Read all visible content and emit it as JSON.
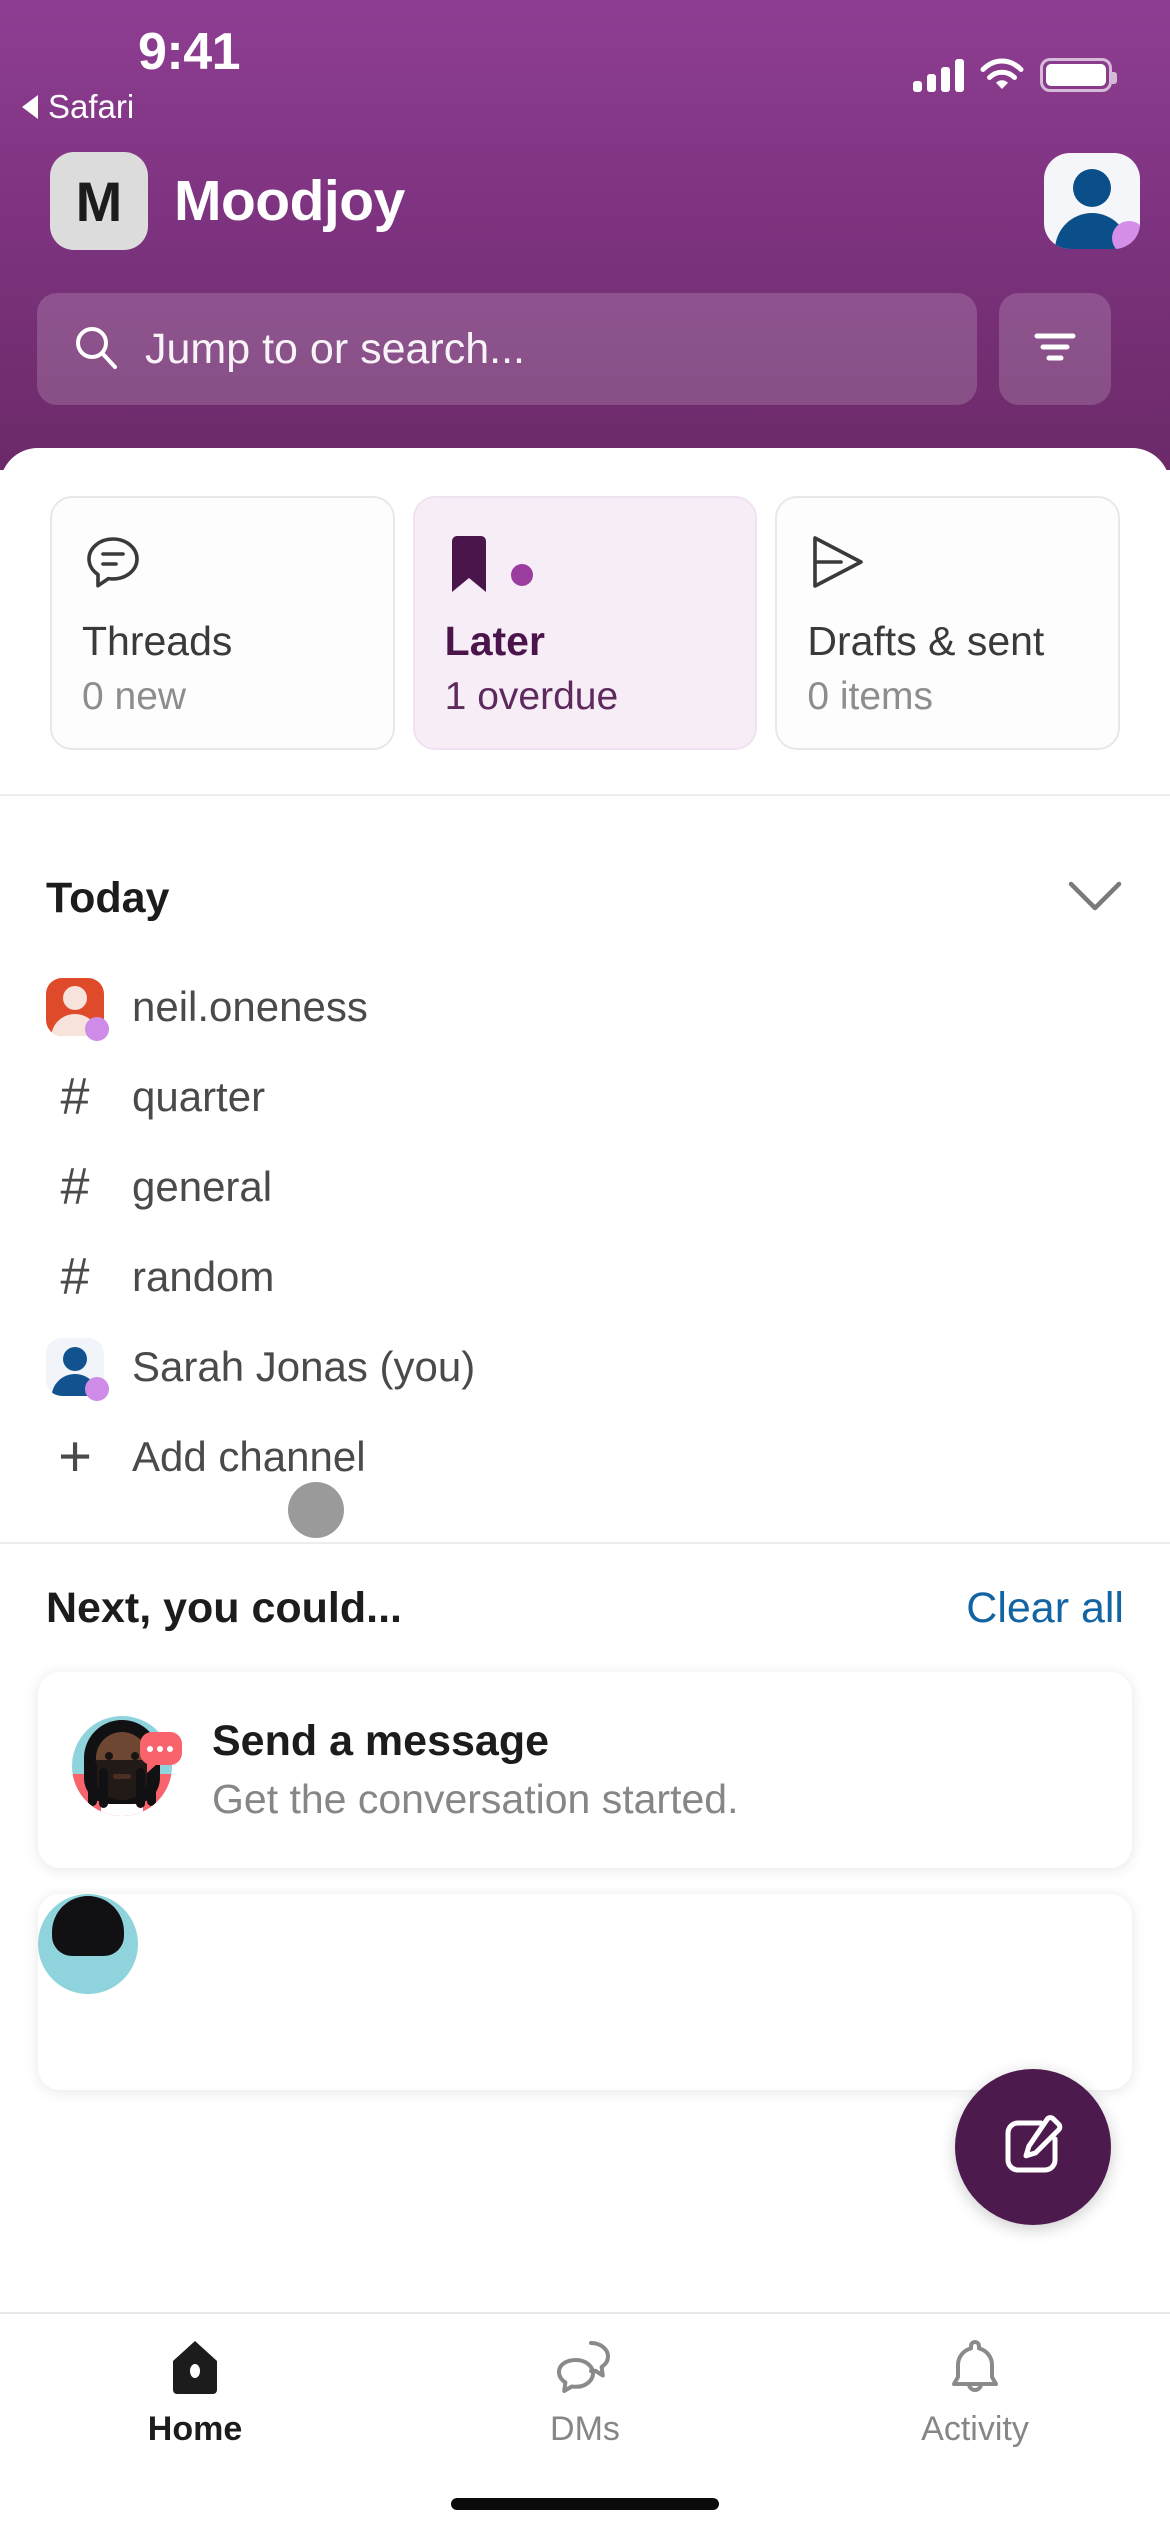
{
  "status_bar": {
    "time": "9:41",
    "back_app_label": "Safari",
    "signal_icon": "cellular-signal-icon",
    "wifi_icon": "wifi-icon",
    "battery_icon": "battery-icon"
  },
  "header": {
    "workspace_initial": "M",
    "workspace_name": "Moodjoy",
    "avatar_icon": "user-avatar-icon",
    "accent_purple": "#7E3380",
    "dark_purple": "#4A154B"
  },
  "search": {
    "placeholder": "Jump to or search...",
    "search_icon": "search-icon",
    "filter_icon": "filter-icon"
  },
  "quick_cards": [
    {
      "icon": "threads-icon",
      "title": "Threads",
      "subtitle": "0 new",
      "active": false,
      "badge": false
    },
    {
      "icon": "bookmark-icon",
      "title": "Later",
      "subtitle": "1 overdue",
      "active": true,
      "badge": true
    },
    {
      "icon": "paper-plane-icon",
      "title": "Drafts & sent",
      "subtitle": "0 items",
      "active": false,
      "badge": false
    }
  ],
  "today": {
    "label": "Today",
    "collapse_icon": "chevron-down-icon",
    "items": [
      {
        "type": "dm",
        "avatar": "avatar-red",
        "name": "neil.oneness",
        "presence": true
      },
      {
        "type": "channel",
        "icon": "hash-icon",
        "name": "quarter"
      },
      {
        "type": "channel",
        "icon": "hash-icon",
        "name": "general"
      },
      {
        "type": "channel",
        "icon": "hash-icon",
        "name": "random"
      },
      {
        "type": "dm",
        "avatar": "avatar-blue",
        "name": "Sarah Jonas (you)",
        "presence": true
      },
      {
        "type": "action",
        "icon": "plus-icon",
        "name": "Add channel"
      }
    ]
  },
  "next_section": {
    "label": "Next, you could...",
    "clear_all": "Clear all",
    "clear_all_color": "#1264A3",
    "suggestions": [
      {
        "avatar": "illustration-avatar-person-with-locs",
        "title": "Send a message",
        "subtitle": "Get the conversation started."
      }
    ]
  },
  "compose_fab": {
    "icon": "compose-icon",
    "color": "#4D1A4D"
  },
  "tabbar": {
    "tabs": [
      {
        "icon": "home-icon",
        "label": "Home",
        "active": true
      },
      {
        "icon": "dms-icon",
        "label": "DMs",
        "active": false
      },
      {
        "icon": "bell-icon",
        "label": "Activity",
        "active": false
      }
    ]
  },
  "touch_indicator": {
    "name": "touch-point-indicator",
    "color": "#9A9A9A"
  }
}
